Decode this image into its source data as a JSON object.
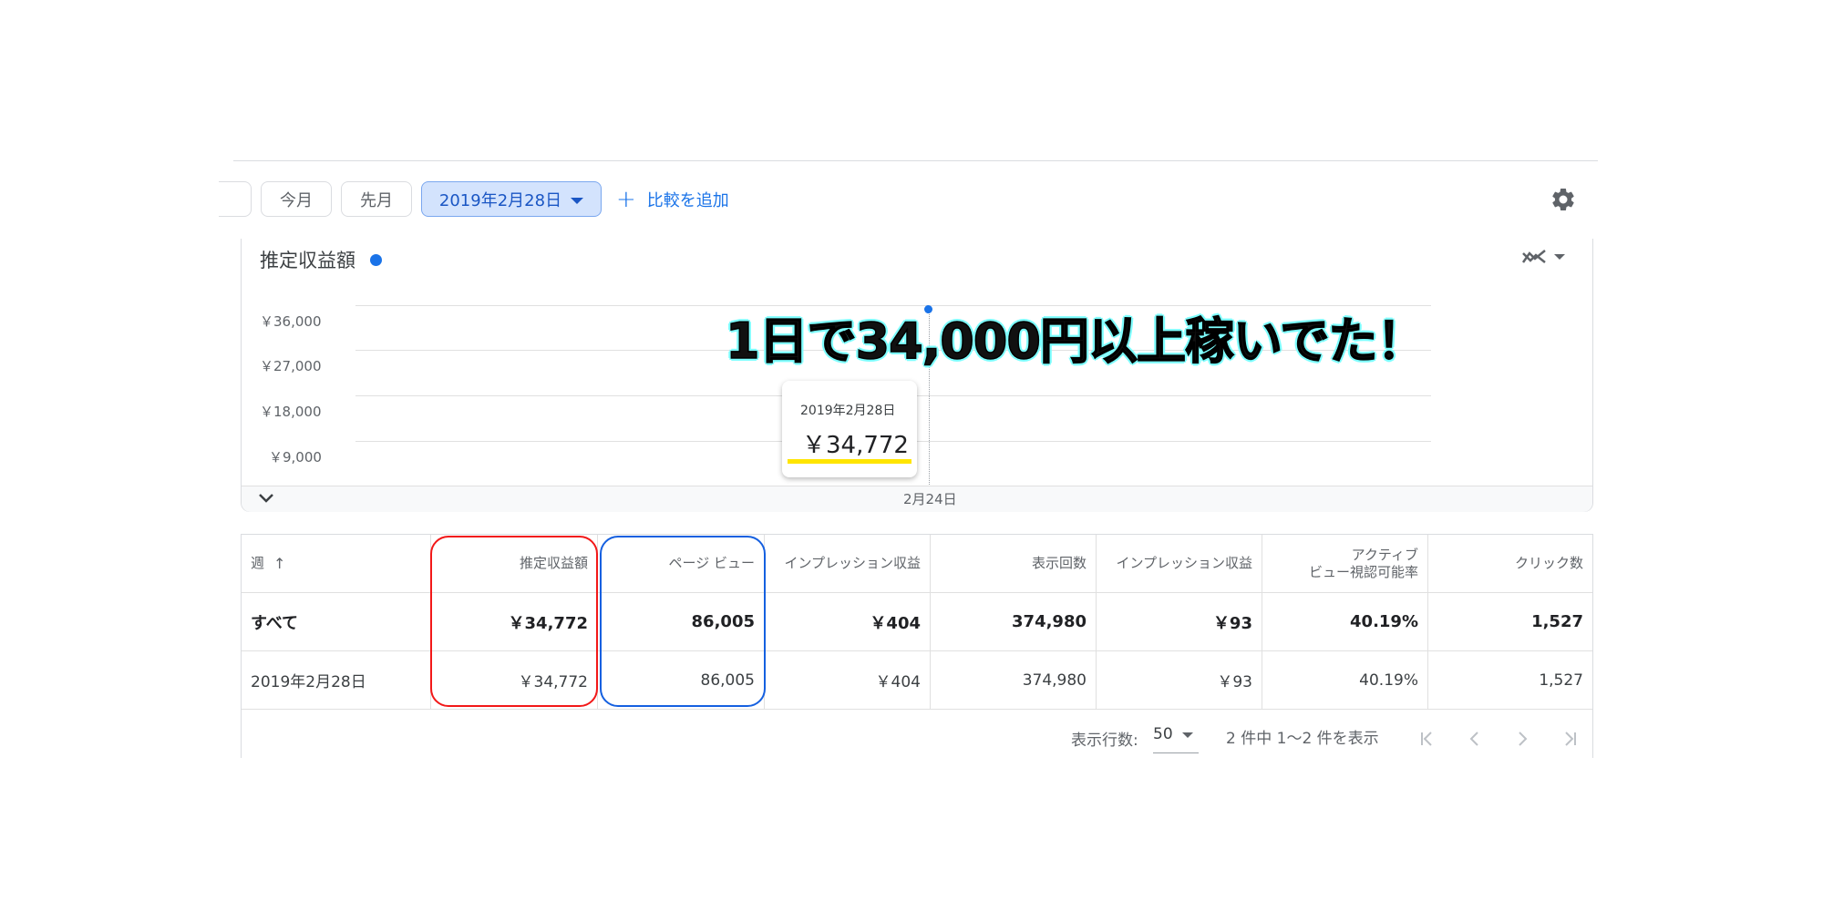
{
  "toolbar": {
    "chip_this_month": "今月",
    "chip_last_month": "先月",
    "date_chip": "2019年2月28日",
    "add_compare": "比較を追加"
  },
  "chart": {
    "title": "推定収益額",
    "series_color": "#1a73e8",
    "yticks": [
      "￥36,000",
      "￥27,000",
      "￥18,000",
      "￥9,000"
    ],
    "xtick": "2月24日",
    "tooltip": {
      "date": "2019年2月28日",
      "value": "￥34,772"
    }
  },
  "chart_data": {
    "type": "line",
    "x": [
      "2019-02-28"
    ],
    "series": [
      {
        "values": [
          34772
        ]
      }
    ],
    "title": "推定収益額",
    "ylim": [
      0,
      36000
    ],
    "yticks": [
      9000,
      18000,
      27000,
      36000
    ],
    "xlabel": "",
    "ylabel": ""
  },
  "annotation": {
    "headline": "1日で34,000円以上稼いでた！",
    "headline_fill": "#111111",
    "headline_outline": "#7fffff",
    "underline_color": "#ffe500",
    "red_box_color": "#f21818",
    "blue_box_color": "#1560e0"
  },
  "table": {
    "headers": [
      "週",
      "推定収益額",
      "ページ ビュー",
      "インプレッション収益",
      "表示回数",
      "インプレッション収益",
      "アクティブ\nビュー視認可能率",
      "クリック数"
    ],
    "rows": [
      [
        "すべて",
        "￥34,772",
        "86,005",
        "￥404",
        "374,980",
        "￥93",
        "40.19%",
        "1,527"
      ],
      [
        "2019年2月28日",
        "￥34,772",
        "86,005",
        "￥404",
        "374,980",
        "￥93",
        "40.19%",
        "1,527"
      ]
    ]
  },
  "footer": {
    "rows_label": "表示行数:",
    "rows_value": "50",
    "range_text": "2 件中 1～2 件を表示"
  },
  "icons": [
    "gear-icon",
    "trend-chart-icon",
    "chevron-down-icon",
    "sort-up-icon",
    "first-page-icon",
    "prev-page-icon",
    "next-page-icon",
    "last-page-icon"
  ]
}
